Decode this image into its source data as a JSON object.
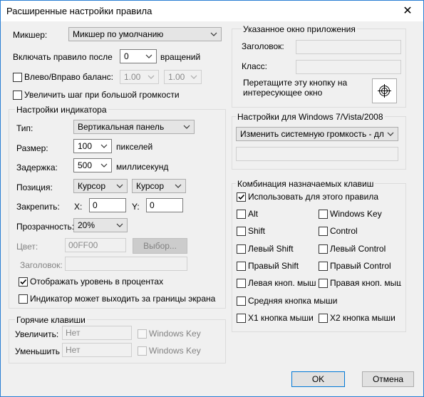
{
  "window": {
    "title": "Расширенные настройки правила",
    "close_glyph": "✕"
  },
  "mixer": {
    "label": "Микшер:",
    "value": "Микшер по умолчанию"
  },
  "enable_after": {
    "label": "Включать правило после",
    "value": "0",
    "suffix": "вращений"
  },
  "balance": {
    "label": "Влево/Вправо баланс:",
    "left_value": "1.00",
    "right_value": "1.00",
    "checked": false
  },
  "increase_step": {
    "label": "Увеличить шаг при большой громкости",
    "checked": false
  },
  "indicator": {
    "group_title": "Настройки индикатора",
    "type_label": "Тип:",
    "type_value": "Вертикальная панель",
    "size_label": "Размер:",
    "size_value": "100",
    "size_unit": "пикселей",
    "delay_label": "Задержка:",
    "delay_value": "500",
    "delay_unit": "миллисекунд",
    "position_label": "Позиция:",
    "position_x": "Курсор",
    "position_y": "Курсор",
    "pin_label": "Закрепить:",
    "pin_x_label": "X:",
    "pin_x_value": "0",
    "pin_y_label": "Y:",
    "pin_y_value": "0",
    "opacity_label": "Прозрачность:",
    "opacity_value": "20%",
    "color_label": "Цвет:",
    "color_value": "00FF00",
    "choose_button": "Выбор...",
    "heading_label": "Заголовок:",
    "heading_value": "",
    "show_percent_label": "Отображать уровень в процентах",
    "show_percent_checked": true,
    "offscreen_label": "Индикатор может выходить за границы экрана",
    "offscreen_checked": false
  },
  "hotkeys": {
    "group_title": "Горячие клавиши",
    "increase_label": "Увеличить:",
    "increase_value": "Нет",
    "increase_winkey": "Windows Key",
    "decrease_label": "Уменьшить",
    "decrease_value": "Нет",
    "decrease_winkey": "Windows Key"
  },
  "app_window": {
    "group_title": "Указанное окно приложения",
    "title_label": "Заголовок:",
    "title_value": "",
    "class_label": "Класс:",
    "class_value": "",
    "drag_hint": "Перетащите эту кнопку на интересующее окно",
    "crosshair_icon": "crosshair-target-icon"
  },
  "win7": {
    "group_title": "Настройки для Windows 7/Vista/2008",
    "action_value": "Изменить системную громкость - для в",
    "extra_value": ""
  },
  "combo": {
    "group_title": "Комбинация назначаемых клавиш",
    "use_for_rule": "Использовать для этого правила",
    "use_for_rule_checked": true,
    "keys": [
      {
        "label": "Alt"
      },
      {
        "label": "Windows Key"
      },
      {
        "label": "Shift"
      },
      {
        "label": "Control"
      },
      {
        "label": "Левый Shift"
      },
      {
        "label": "Левый Control"
      },
      {
        "label": "Правый Shift"
      },
      {
        "label": "Правый Control"
      },
      {
        "label": "Левая кноп. мыши"
      },
      {
        "label": "Правая кноп. мыши"
      },
      {
        "label": "Средняя кнопка мыши"
      },
      {
        "label": "X1 кнопка мыши"
      },
      {
        "label": "X2 кнопка мыши"
      }
    ]
  },
  "footer": {
    "ok": "OK",
    "cancel": "Отмена"
  },
  "colors": {
    "accent": "#0078d7",
    "window_bg": "#f0f0f0",
    "title_bg": "#ffffff"
  }
}
